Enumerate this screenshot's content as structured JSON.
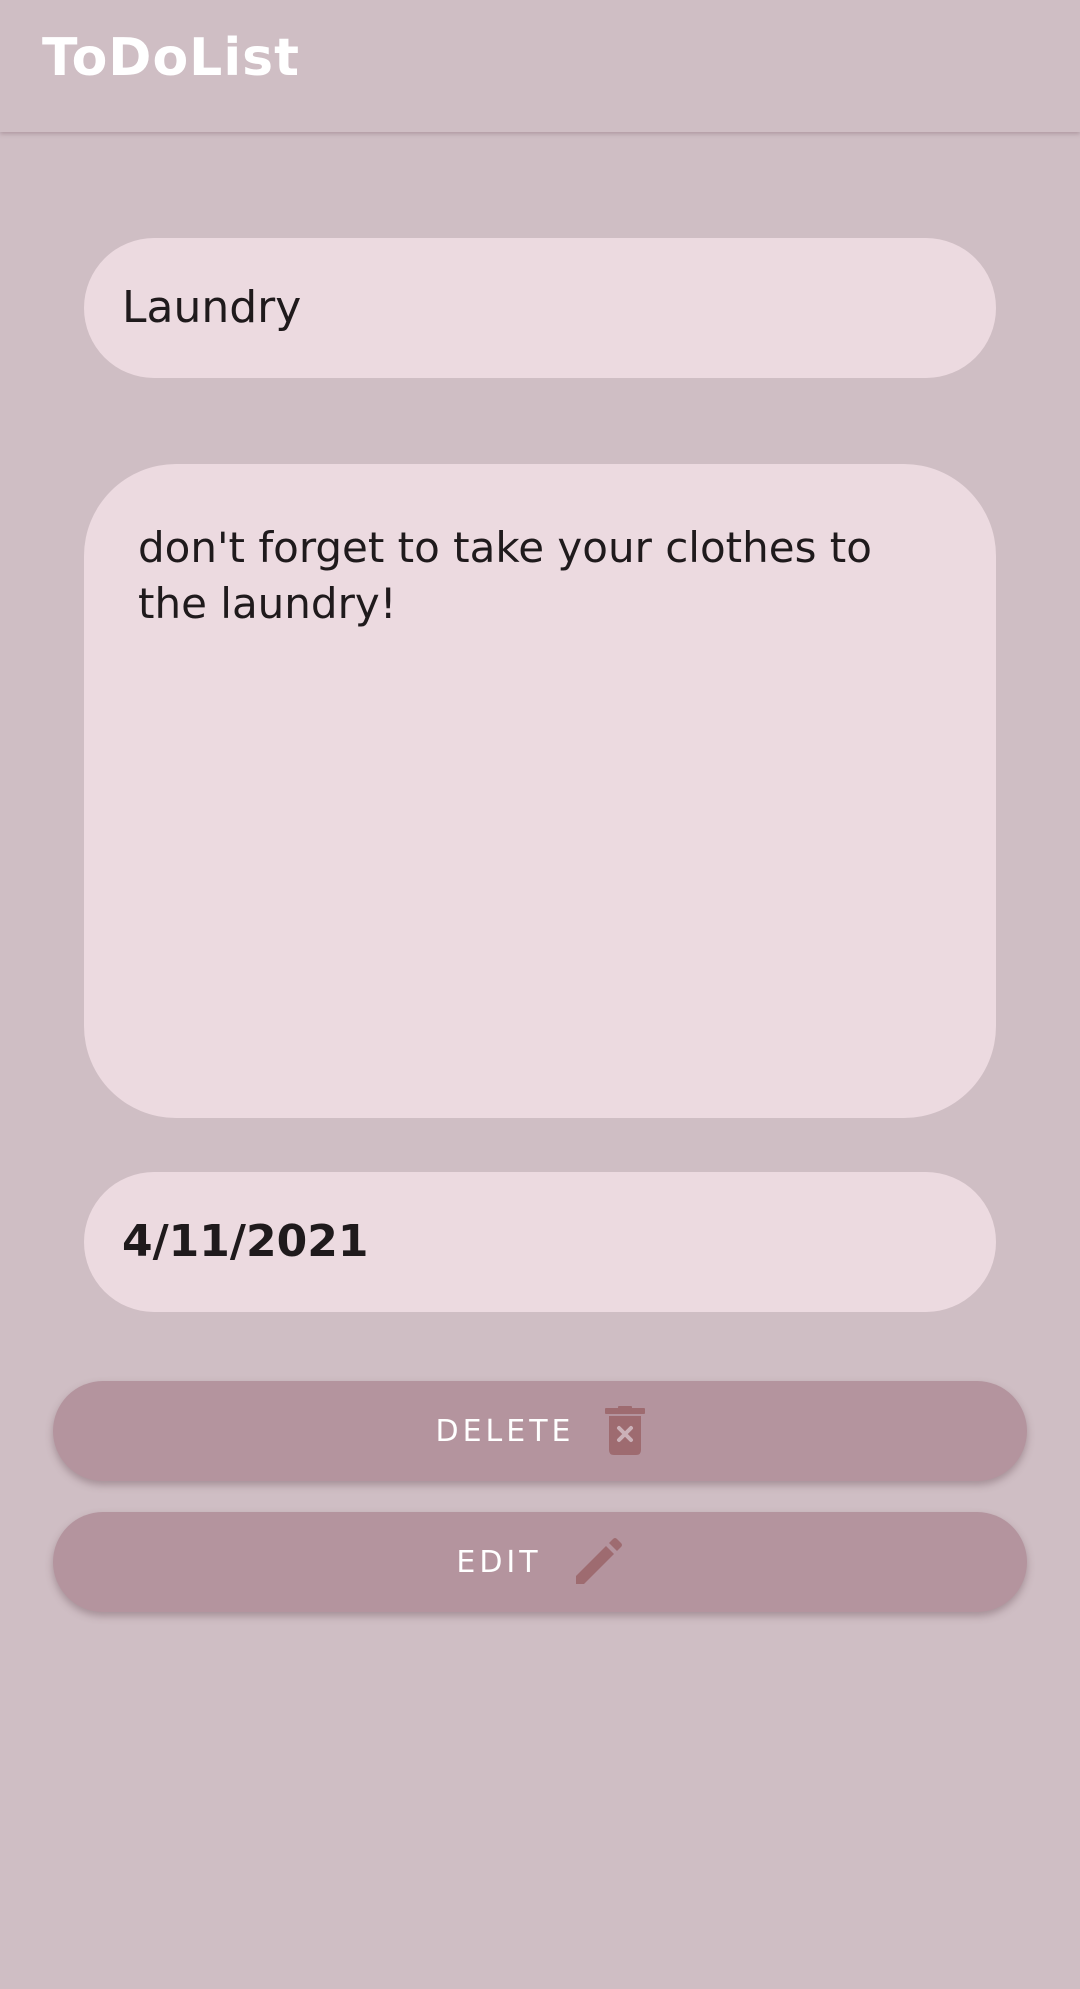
{
  "app_bar": {
    "title": "ToDoList"
  },
  "form": {
    "title_value": "Laundry",
    "description_value": "don't forget to take your clothes to the laundry!",
    "date_value": "4/11/2021"
  },
  "actions": {
    "delete_label": "DELETE",
    "delete_icon": "trash-icon",
    "edit_label": "EDIT",
    "edit_icon": "pencil-icon"
  },
  "colors": {
    "background": "#cfbec4",
    "field": "#ecdae0",
    "button": "#b4949e",
    "icon": "#9e6b70",
    "text": "#1f1a1c"
  }
}
